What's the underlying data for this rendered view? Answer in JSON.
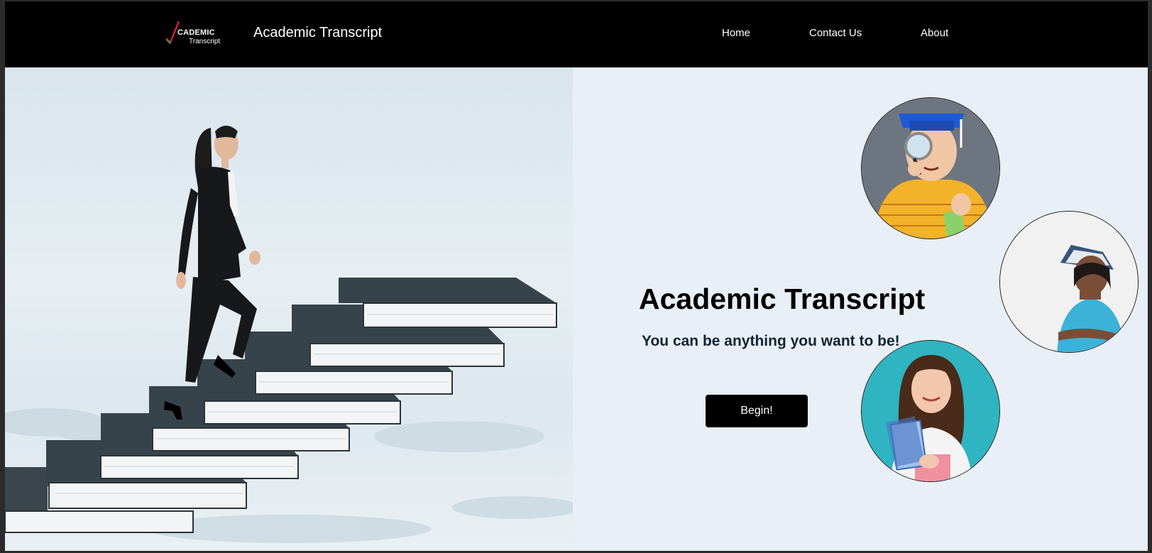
{
  "navbar": {
    "logo_line1": "CADEMIC",
    "logo_line2": "Transcript",
    "brand": "Academic Transcript",
    "links": [
      {
        "label": "Home"
      },
      {
        "label": "Contact Us"
      },
      {
        "label": "About"
      }
    ]
  },
  "hero": {
    "title": "Academic Transcript",
    "subtitle": "You can be anything you want to be!",
    "cta_label": "Begin!"
  },
  "colors": {
    "navbar_bg": "#000000",
    "page_bg": "#e8eff6",
    "button_bg": "#000000",
    "book_cover": "#37434a"
  }
}
